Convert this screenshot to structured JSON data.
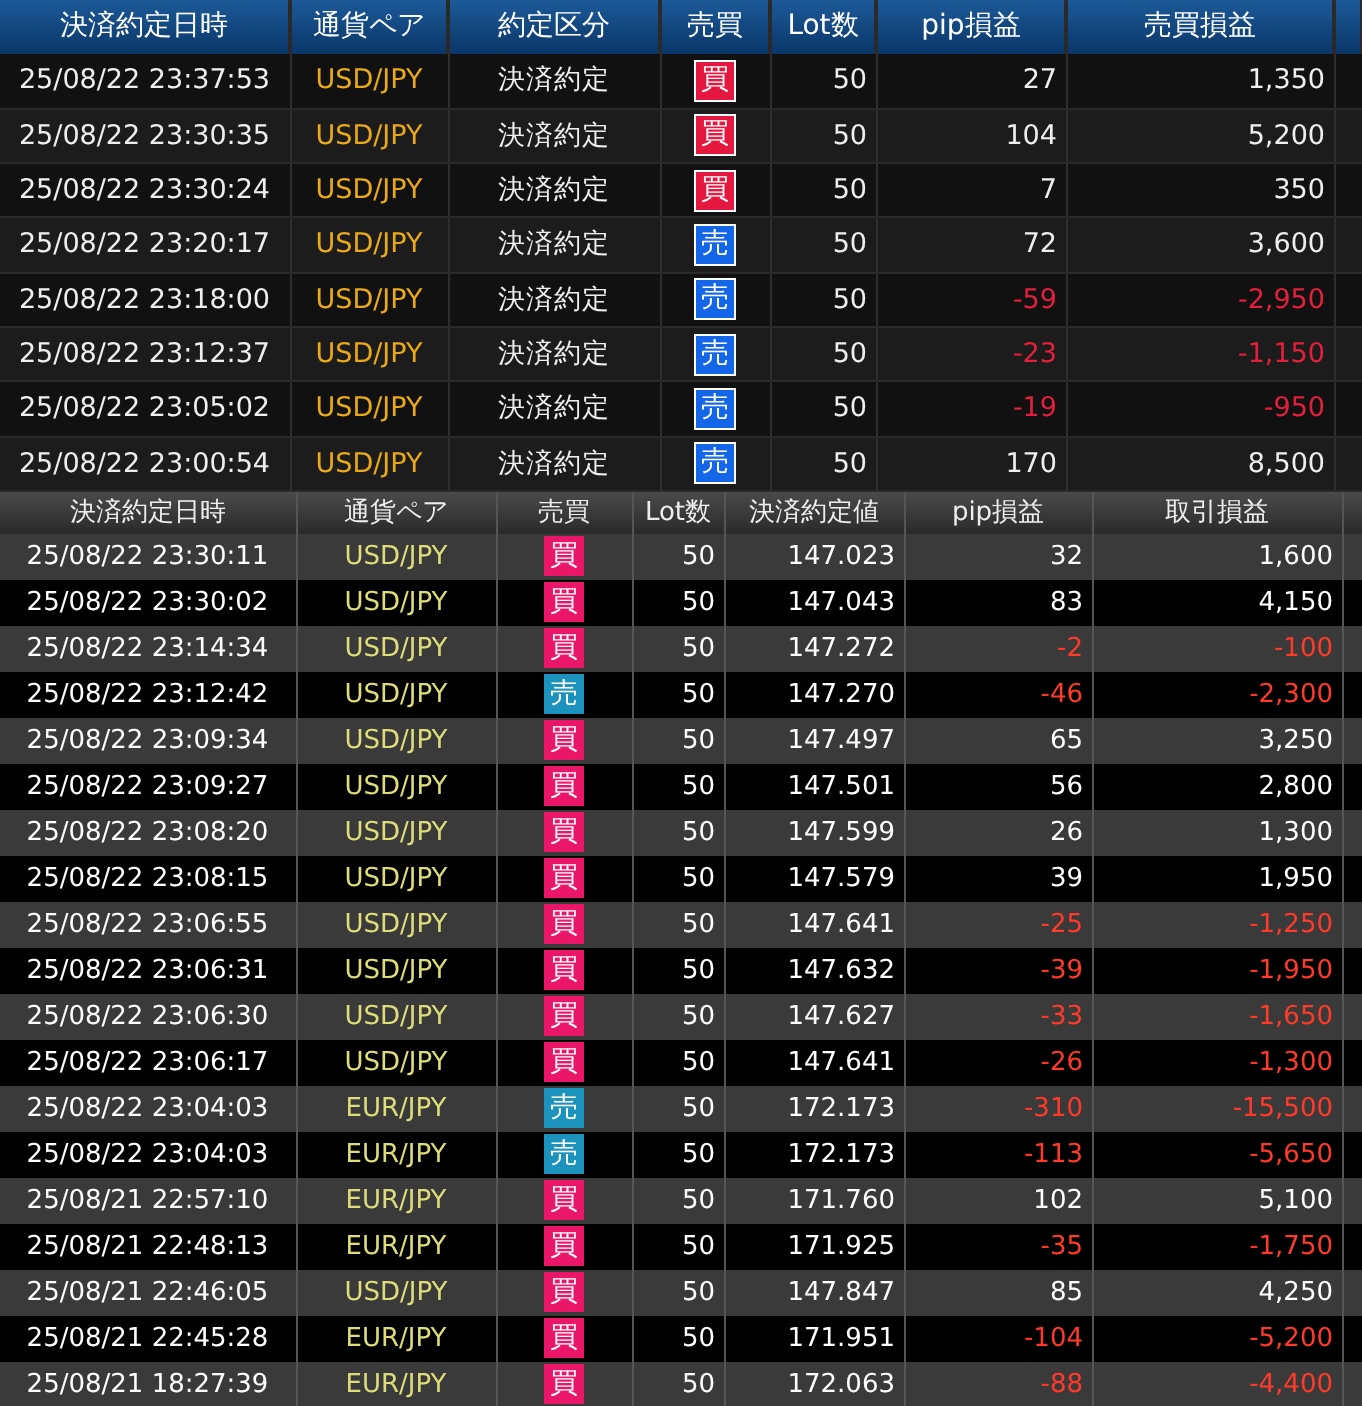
{
  "settlement_table": {
    "columns": [
      "決済約定日時",
      "通貨ペア",
      "約定区分",
      "売買",
      "Lot数",
      "pip損益",
      "売買損益"
    ],
    "rows": [
      {
        "datetime": "25/08/22 23:37:53",
        "pair": "USD/JPY",
        "type": "決済約定",
        "side": "買",
        "kind": "buy",
        "lots": "50",
        "pips": "27",
        "profit": "1,350",
        "loss": false
      },
      {
        "datetime": "25/08/22 23:30:35",
        "pair": "USD/JPY",
        "type": "決済約定",
        "side": "買",
        "kind": "buy",
        "lots": "50",
        "pips": "104",
        "profit": "5,200",
        "loss": false
      },
      {
        "datetime": "25/08/22 23:30:24",
        "pair": "USD/JPY",
        "type": "決済約定",
        "side": "買",
        "kind": "buy",
        "lots": "50",
        "pips": "7",
        "profit": "350",
        "loss": false
      },
      {
        "datetime": "25/08/22 23:20:17",
        "pair": "USD/JPY",
        "type": "決済約定",
        "side": "売",
        "kind": "sell",
        "lots": "50",
        "pips": "72",
        "profit": "3,600",
        "loss": false
      },
      {
        "datetime": "25/08/22 23:18:00",
        "pair": "USD/JPY",
        "type": "決済約定",
        "side": "売",
        "kind": "sell",
        "lots": "50",
        "pips": "-59",
        "profit": "-2,950",
        "loss": true
      },
      {
        "datetime": "25/08/22 23:12:37",
        "pair": "USD/JPY",
        "type": "決済約定",
        "side": "売",
        "kind": "sell",
        "lots": "50",
        "pips": "-23",
        "profit": "-1,150",
        "loss": true
      },
      {
        "datetime": "25/08/22 23:05:02",
        "pair": "USD/JPY",
        "type": "決済約定",
        "side": "売",
        "kind": "sell",
        "lots": "50",
        "pips": "-19",
        "profit": "-950",
        "loss": true
      },
      {
        "datetime": "25/08/22 23:00:54",
        "pair": "USD/JPY",
        "type": "決済約定",
        "side": "売",
        "kind": "sell",
        "lots": "50",
        "pips": "170",
        "profit": "8,500",
        "loss": false
      }
    ]
  },
  "history_table": {
    "columns": [
      "決済約定日時",
      "通貨ペア",
      "売買",
      "Lot数",
      "決済約定値",
      "pip損益",
      "取引損益"
    ],
    "rows": [
      {
        "datetime": "25/08/22 23:30:11",
        "pair": "USD/JPY",
        "side": "買",
        "kind": "buy",
        "lots": "50",
        "price": "147.023",
        "pips": "32",
        "profit": "1,600",
        "loss": false
      },
      {
        "datetime": "25/08/22 23:30:02",
        "pair": "USD/JPY",
        "side": "買",
        "kind": "buy",
        "lots": "50",
        "price": "147.043",
        "pips": "83",
        "profit": "4,150",
        "loss": false
      },
      {
        "datetime": "25/08/22 23:14:34",
        "pair": "USD/JPY",
        "side": "買",
        "kind": "buy",
        "lots": "50",
        "price": "147.272",
        "pips": "-2",
        "profit": "-100",
        "loss": true
      },
      {
        "datetime": "25/08/22 23:12:42",
        "pair": "USD/JPY",
        "side": "売",
        "kind": "sell",
        "lots": "50",
        "price": "147.270",
        "pips": "-46",
        "profit": "-2,300",
        "loss": true
      },
      {
        "datetime": "25/08/22 23:09:34",
        "pair": "USD/JPY",
        "side": "買",
        "kind": "buy",
        "lots": "50",
        "price": "147.497",
        "pips": "65",
        "profit": "3,250",
        "loss": false
      },
      {
        "datetime": "25/08/22 23:09:27",
        "pair": "USD/JPY",
        "side": "買",
        "kind": "buy",
        "lots": "50",
        "price": "147.501",
        "pips": "56",
        "profit": "2,800",
        "loss": false
      },
      {
        "datetime": "25/08/22 23:08:20",
        "pair": "USD/JPY",
        "side": "買",
        "kind": "buy",
        "lots": "50",
        "price": "147.599",
        "pips": "26",
        "profit": "1,300",
        "loss": false
      },
      {
        "datetime": "25/08/22 23:08:15",
        "pair": "USD/JPY",
        "side": "買",
        "kind": "buy",
        "lots": "50",
        "price": "147.579",
        "pips": "39",
        "profit": "1,950",
        "loss": false
      },
      {
        "datetime": "25/08/22 23:06:55",
        "pair": "USD/JPY",
        "side": "買",
        "kind": "buy",
        "lots": "50",
        "price": "147.641",
        "pips": "-25",
        "profit": "-1,250",
        "loss": true
      },
      {
        "datetime": "25/08/22 23:06:31",
        "pair": "USD/JPY",
        "side": "買",
        "kind": "buy",
        "lots": "50",
        "price": "147.632",
        "pips": "-39",
        "profit": "-1,950",
        "loss": true
      },
      {
        "datetime": "25/08/22 23:06:30",
        "pair": "USD/JPY",
        "side": "買",
        "kind": "buy",
        "lots": "50",
        "price": "147.627",
        "pips": "-33",
        "profit": "-1,650",
        "loss": true
      },
      {
        "datetime": "25/08/22 23:06:17",
        "pair": "USD/JPY",
        "side": "買",
        "kind": "buy",
        "lots": "50",
        "price": "147.641",
        "pips": "-26",
        "profit": "-1,300",
        "loss": true
      },
      {
        "datetime": "25/08/22 23:04:03",
        "pair": "EUR/JPY",
        "side": "売",
        "kind": "sell",
        "lots": "50",
        "price": "172.173",
        "pips": "-310",
        "profit": "-15,500",
        "loss": true
      },
      {
        "datetime": "25/08/22 23:04:03",
        "pair": "EUR/JPY",
        "side": "売",
        "kind": "sell",
        "lots": "50",
        "price": "172.173",
        "pips": "-113",
        "profit": "-5,650",
        "loss": true
      },
      {
        "datetime": "25/08/21 22:57:10",
        "pair": "EUR/JPY",
        "side": "買",
        "kind": "buy",
        "lots": "50",
        "price": "171.760",
        "pips": "102",
        "profit": "5,100",
        "loss": false
      },
      {
        "datetime": "25/08/21 22:48:13",
        "pair": "EUR/JPY",
        "side": "買",
        "kind": "buy",
        "lots": "50",
        "price": "171.925",
        "pips": "-35",
        "profit": "-1,750",
        "loss": true
      },
      {
        "datetime": "25/08/21 22:46:05",
        "pair": "USD/JPY",
        "side": "買",
        "kind": "buy",
        "lots": "50",
        "price": "147.847",
        "pips": "85",
        "profit": "4,250",
        "loss": false
      },
      {
        "datetime": "25/08/21 22:45:28",
        "pair": "EUR/JPY",
        "side": "買",
        "kind": "buy",
        "lots": "50",
        "price": "171.951",
        "pips": "-104",
        "profit": "-5,200",
        "loss": true
      },
      {
        "datetime": "25/08/21 18:27:39",
        "pair": "EUR/JPY",
        "side": "買",
        "kind": "buy",
        "lots": "50",
        "price": "172.063",
        "pips": "-88",
        "profit": "-4,400",
        "loss": true
      }
    ]
  }
}
